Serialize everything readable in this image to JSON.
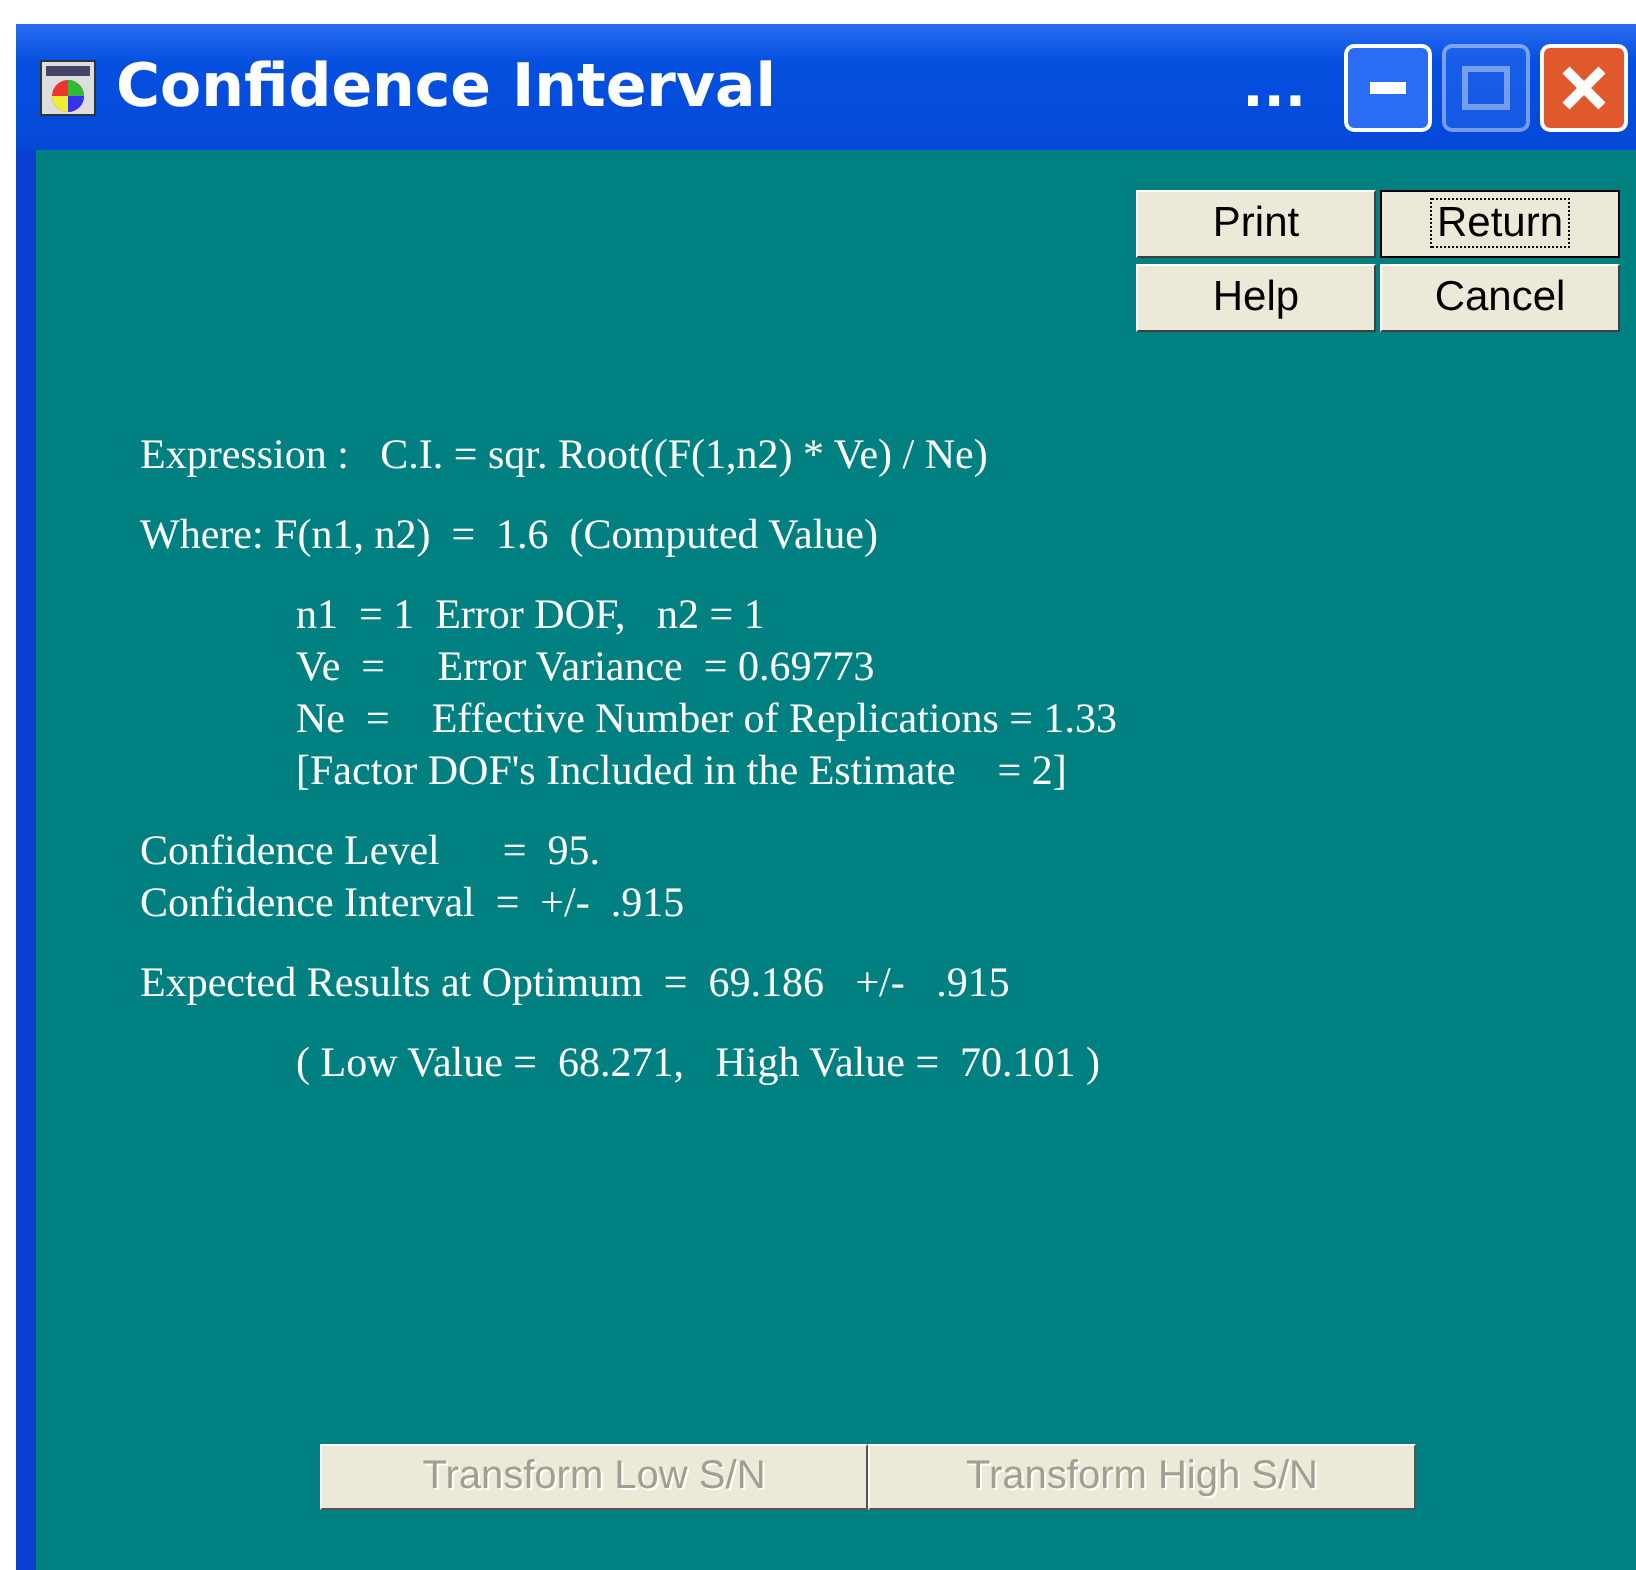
{
  "window": {
    "title": "Confidence Interval",
    "title_suffix": "...",
    "controls": [
      {
        "kind": "minimize",
        "disabled": false
      },
      {
        "kind": "maximize",
        "disabled": true
      },
      {
        "kind": "close",
        "disabled": false
      }
    ]
  },
  "buttons": [
    {
      "label": "Print",
      "focused": false
    },
    {
      "label": "Return",
      "focused": true
    },
    {
      "label": "Help",
      "focused": false
    },
    {
      "label": "Cancel",
      "focused": false
    }
  ],
  "sections": [
    {
      "indented": false,
      "lines": [
        "Expression :   C.I. = sqr. Root((F(1,n2) * Ve) / Ne)"
      ]
    },
    {
      "indented": false,
      "lines": [
        "Where: F(n1, n2)  =  1.6  (Computed Value)"
      ]
    },
    {
      "indented": true,
      "lines": [
        "n1  = 1  Error DOF,   n2 = 1",
        "Ve  =     Error Variance  = 0.69773",
        "Ne  =    Effective Number of Replications = 1.33",
        "[Factor DOF's Included in the Estimate    = 2]"
      ]
    },
    {
      "indented": false,
      "lines": [
        "Confidence Level      =  95.",
        "Confidence Interval  =  +/-  .915"
      ]
    },
    {
      "indented": false,
      "lines": [
        "Expected Results at Optimum  =  69.186   +/-   .915"
      ]
    },
    {
      "indented": true,
      "lines": [
        "( Low Value =  68.271,   High Value =  70.101 )"
      ]
    }
  ],
  "bottom_buttons": [
    {
      "label": "Transform Low S/N",
      "disabled": true
    },
    {
      "label": "Transform High S/N",
      "disabled": true
    }
  ]
}
